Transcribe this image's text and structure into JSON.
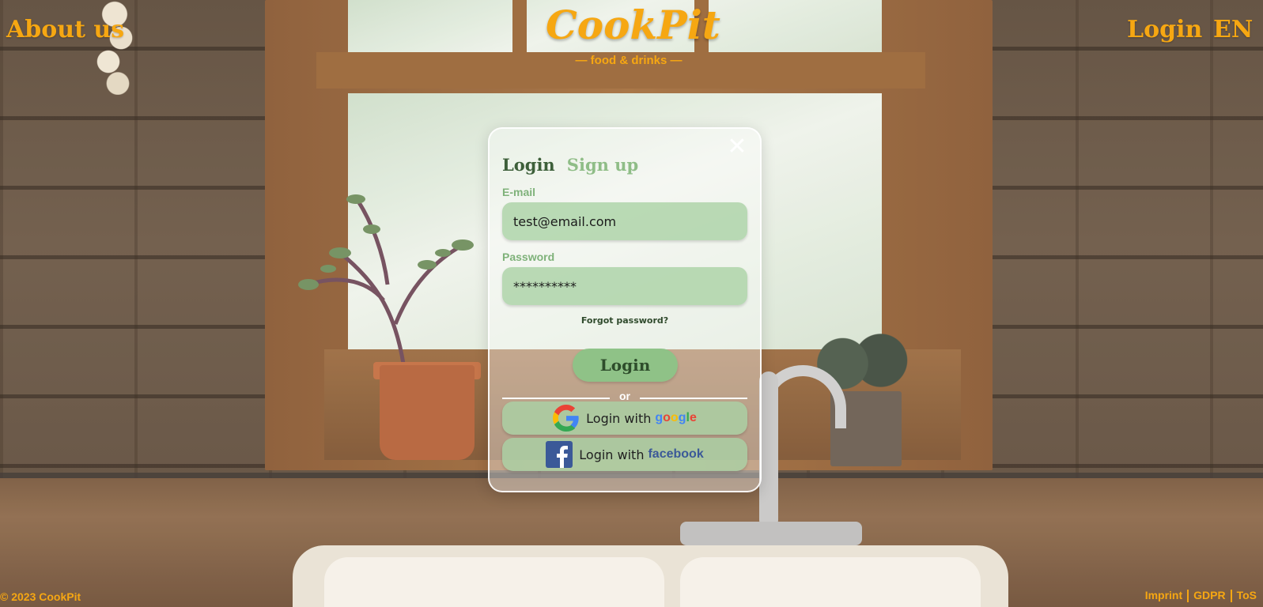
{
  "header": {
    "about_label": "About us",
    "logo_name": "CookPit",
    "logo_tagline": "— food & drinks —",
    "login_label": "Login",
    "language_label": "EN"
  },
  "modal": {
    "close_symbol": "✕",
    "tabs": [
      {
        "label": "Login",
        "active": true
      },
      {
        "label": "Sign up",
        "active": false
      }
    ],
    "email": {
      "label": "E-mail",
      "value": "test@email.com"
    },
    "password": {
      "label": "Password",
      "value": "**********"
    },
    "forgot_label": "Forgot password?",
    "submit_label": "Login",
    "divider_label": "or",
    "google": {
      "prefix": "Login with",
      "brand": "google"
    },
    "facebook": {
      "prefix": "Login with",
      "brand": "facebook"
    }
  },
  "footer": {
    "copyright": "© 2023 CookPit",
    "links": [
      "Imprint",
      "GDPR",
      "ToS"
    ]
  },
  "colors": {
    "accent": "#f6a712",
    "modal_field": "#aad2a5",
    "tab_active": "#3d5f3a",
    "tab_inactive": "#8fbd87"
  },
  "icons": [
    "close-icon",
    "google-icon",
    "facebook-icon"
  ]
}
